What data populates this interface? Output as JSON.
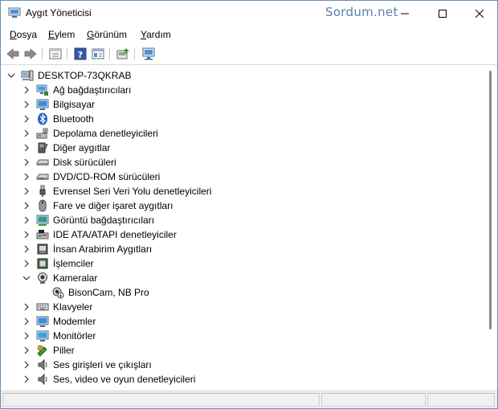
{
  "window": {
    "title": "Aygıt Yöneticisi",
    "watermark": "Sordum.net"
  },
  "menu": [
    {
      "label": "Dosya",
      "key": "D",
      "rest": "osya"
    },
    {
      "label": "Eylem",
      "key": "E",
      "rest": "ylem"
    },
    {
      "label": "Görünüm",
      "key": "G",
      "rest": "örünüm"
    },
    {
      "label": "Yardım",
      "key": "Y",
      "rest": "ardım"
    }
  ],
  "toolbar": {
    "icons": [
      "back-icon",
      "forward-icon",
      "properties-icon",
      "help-icon",
      "console-icon",
      "update-driver-icon",
      "scan-hardware-icon"
    ]
  },
  "tree": {
    "root": "DESKTOP-73QKRAB",
    "categories": [
      "Ağ bağdaştırıcıları",
      "Bilgisayar",
      "Bluetooth",
      "Depolama denetleyicileri",
      "Diğer aygıtlar",
      "Disk sürücüleri",
      "DVD/CD-ROM sürücüleri",
      "Evrensel Seri Veri Yolu denetleyicileri",
      "Fare ve diğer işaret aygıtları",
      "Görüntü bağdaştırıcıları",
      "IDE ATA/ATAPI denetleyiciler",
      "İnsan Arabirim Aygıtları",
      "İşlemciler",
      "Kameralar",
      "Klavyeler",
      "Modemler",
      "Monitörler",
      "Piller",
      "Ses girişleri ve çıkışları",
      "Ses, video ve oyun denetleyicileri"
    ],
    "expanded_category": "Kameralar",
    "camera_child": "BisonCam, NB Pro"
  },
  "colors": {
    "accent": "#3a7bd5",
    "watermark": "#5a7fb0"
  }
}
